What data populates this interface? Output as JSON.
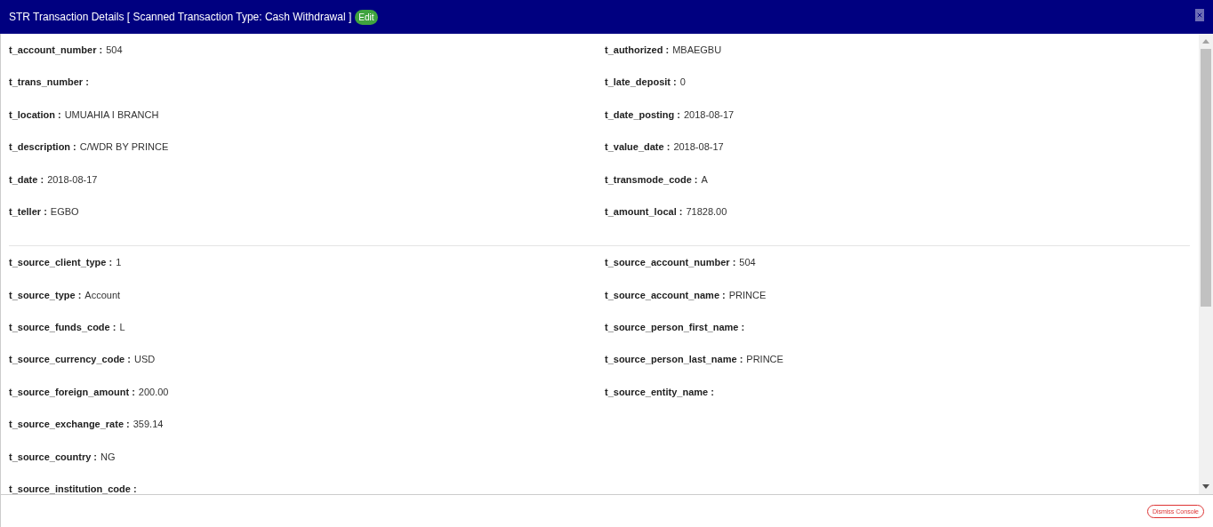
{
  "header": {
    "title": "STR Transaction Details [ Scanned Transaction Type: Cash Withdrawal ]",
    "edit_button": "Edit"
  },
  "sections": [
    {
      "left": [
        {
          "label": "t_account_number :",
          "value": "504"
        },
        {
          "label": "t_trans_number :"
        },
        {
          "label": "t_location :",
          "value": "UMUAHIA I BRANCH"
        },
        {
          "label": "t_description :",
          "value": "C/WDR BY PRINCE"
        },
        {
          "label": "t_date :",
          "value": "2018-08-17"
        },
        {
          "label": "t_teller :",
          "value": "EGBO"
        }
      ],
      "right": [
        {
          "label": "t_authorized :",
          "value": "MBAEGBU"
        },
        {
          "label": "t_late_deposit :",
          "value": "0"
        },
        {
          "label": "t_date_posting :",
          "value": "2018-08-17"
        },
        {
          "label": "t_value_date :",
          "value": "2018-08-17"
        },
        {
          "label": "t_transmode_code :",
          "value": "A"
        },
        {
          "label": "t_amount_local :",
          "value": "71828.00"
        }
      ]
    },
    {
      "left": [
        {
          "label": "t_source_client_type :",
          "value": "1"
        },
        {
          "label": "t_source_type :",
          "value": "Account"
        },
        {
          "label": "t_source_funds_code :",
          "value": "L"
        },
        {
          "label": "t_source_currency_code :",
          "value": "USD"
        },
        {
          "label": "t_source_foreign_amount :",
          "value": "200.00"
        },
        {
          "label": "t_source_exchange_rate :",
          "value": "359.14"
        },
        {
          "label": "t_source_country :",
          "value": "NG"
        },
        {
          "label": "t_source_institution_code :"
        }
      ],
      "right": [
        {
          "label": "t_source_account_number :",
          "value": "504"
        },
        {
          "label": "t_source_account_name :",
          "value": "PRINCE"
        },
        {
          "label": "t_source_person_first_name :"
        },
        {
          "label": "t_source_person_last_name :",
          "value": "PRINCE"
        },
        {
          "label": "t_source_entity_name :"
        }
      ]
    }
  ],
  "footer": {
    "dismiss_button": "Dismiss Console"
  }
}
